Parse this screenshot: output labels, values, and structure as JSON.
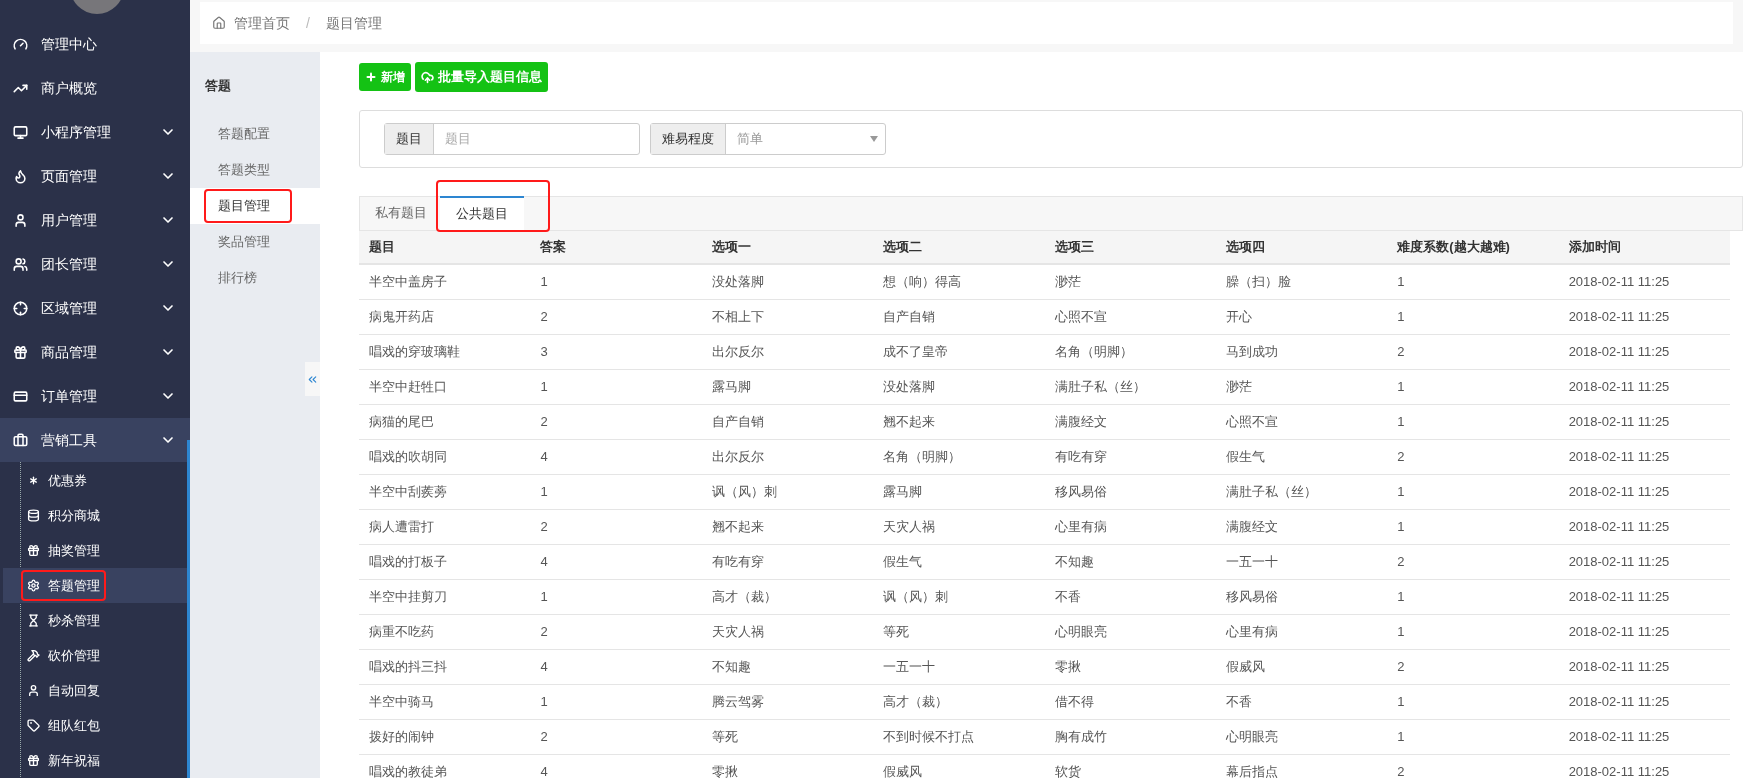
{
  "sidebar": {
    "menu": [
      {
        "label": "管理中心"
      },
      {
        "label": "商户概览"
      },
      {
        "label": "小程序管理",
        "expanded": false
      },
      {
        "label": "页面管理",
        "expanded": false
      },
      {
        "label": "用户管理",
        "expanded": false
      },
      {
        "label": "团长管理",
        "expanded": false
      },
      {
        "label": "区域管理",
        "expanded": false
      },
      {
        "label": "商品管理",
        "expanded": false
      },
      {
        "label": "订单管理",
        "expanded": false
      },
      {
        "label": "营销工具",
        "expanded": true,
        "children": [
          {
            "label": "优惠券",
            "selected": false,
            "annotated": false
          },
          {
            "label": "积分商城",
            "selected": false,
            "annotated": false
          },
          {
            "label": "抽奖管理",
            "selected": false,
            "annotated": false
          },
          {
            "label": "答题管理",
            "selected": true,
            "annotated": true
          },
          {
            "label": "秒杀管理",
            "selected": false,
            "annotated": false
          },
          {
            "label": "砍价管理",
            "selected": false,
            "annotated": false
          },
          {
            "label": "自动回复",
            "selected": false,
            "annotated": false
          },
          {
            "label": "组队红包",
            "selected": false,
            "annotated": false
          },
          {
            "label": "新年祝福",
            "selected": false,
            "annotated": false
          }
        ]
      }
    ]
  },
  "breadcrumb": [
    "管理首页",
    "题目管理"
  ],
  "breadcrumb_separator": "/",
  "submenu": {
    "title": "答题",
    "items": [
      {
        "label": "答题配置",
        "selected": false,
        "annotated": false
      },
      {
        "label": "答题类型",
        "selected": false,
        "annotated": false
      },
      {
        "label": "题目管理",
        "selected": true,
        "annotated": true
      },
      {
        "label": "奖品管理",
        "selected": false,
        "annotated": false
      },
      {
        "label": "排行榜",
        "selected": false,
        "annotated": false
      }
    ]
  },
  "toolbar": {
    "buttons": [
      "新增",
      "批量导入题目信息"
    ]
  },
  "filters": {
    "question": {
      "label": "题目",
      "placeholder": "题目"
    },
    "difficulty": {
      "label": "难易程度",
      "value": "简单"
    }
  },
  "tabs": [
    {
      "label": "私有题目",
      "selected": false,
      "annotated": false
    },
    {
      "label": "公共题目",
      "selected": true,
      "annotated": true
    }
  ],
  "table": {
    "columns": [
      "题目",
      "答案",
      "选项一",
      "选项二",
      "选项三",
      "选项四",
      "难度系数(越大越难)",
      "添加时间"
    ],
    "rows": [
      [
        "半空中盖房子",
        "1",
        "没处落脚",
        "想（响）得高",
        "渺茫",
        "臊（扫）脸",
        "1",
        "2018-02-11 11:25"
      ],
      [
        "病鬼开药店",
        "2",
        "不相上下",
        "自产自销",
        "心照不宣",
        "开心",
        "1",
        "2018-02-11 11:25"
      ],
      [
        "唱戏的穿玻璃鞋",
        "3",
        "出尔反尔",
        "成不了皇帝",
        "名角（明脚）",
        "马到成功",
        "2",
        "2018-02-11 11:25"
      ],
      [
        "半空中赶牲口",
        "1",
        "露马脚",
        "没处落脚",
        "满肚子私（丝）",
        "渺茫",
        "1",
        "2018-02-11 11:25"
      ],
      [
        "病猫的尾巴",
        "2",
        "自产自销",
        "翘不起来",
        "满腹经文",
        "心照不宣",
        "1",
        "2018-02-11 11:25"
      ],
      [
        "唱戏的吹胡同",
        "4",
        "出尔反尔",
        "名角（明脚）",
        "有吃有穿",
        "假生气",
        "2",
        "2018-02-11 11:25"
      ],
      [
        "半空中刮蒺蒡",
        "1",
        "讽（风）刺",
        "露马脚",
        "移风易俗",
        "满肚子私（丝）",
        "1",
        "2018-02-11 11:25"
      ],
      [
        "病人遭雷打",
        "2",
        "翘不起来",
        "天灾人祸",
        "心里有病",
        "满腹经文",
        "1",
        "2018-02-11 11:25"
      ],
      [
        "唱戏的打板子",
        "4",
        "有吃有穿",
        "假生气",
        "不知趣",
        "一五一十",
        "2",
        "2018-02-11 11:25"
      ],
      [
        "半空中挂剪刀",
        "1",
        "高才（裁）",
        "讽（风）刺",
        "不香",
        "移风易俗",
        "1",
        "2018-02-11 11:25"
      ],
      [
        "病重不吃药",
        "2",
        "天灾人祸",
        "等死",
        "心明眼亮",
        "心里有病",
        "1",
        "2018-02-11 11:25"
      ],
      [
        "唱戏的抖三抖",
        "4",
        "不知趣",
        "一五一十",
        "零揪",
        "假威风",
        "2",
        "2018-02-11 11:25"
      ],
      [
        "半空中骑马",
        "1",
        "腾云驾雾",
        "高才（裁）",
        "借不得",
        "不香",
        "1",
        "2018-02-11 11:25"
      ],
      [
        "拨好的闹钟",
        "2",
        "等死",
        "不到时候不打点",
        "胸有成竹",
        "心明眼亮",
        "1",
        "2018-02-11 11:25"
      ],
      [
        "唱戏的教徒弟",
        "4",
        "零揪",
        "假威风",
        "软货",
        "幕后指点",
        "2",
        "2018-02-11 11:25"
      ]
    ]
  }
}
